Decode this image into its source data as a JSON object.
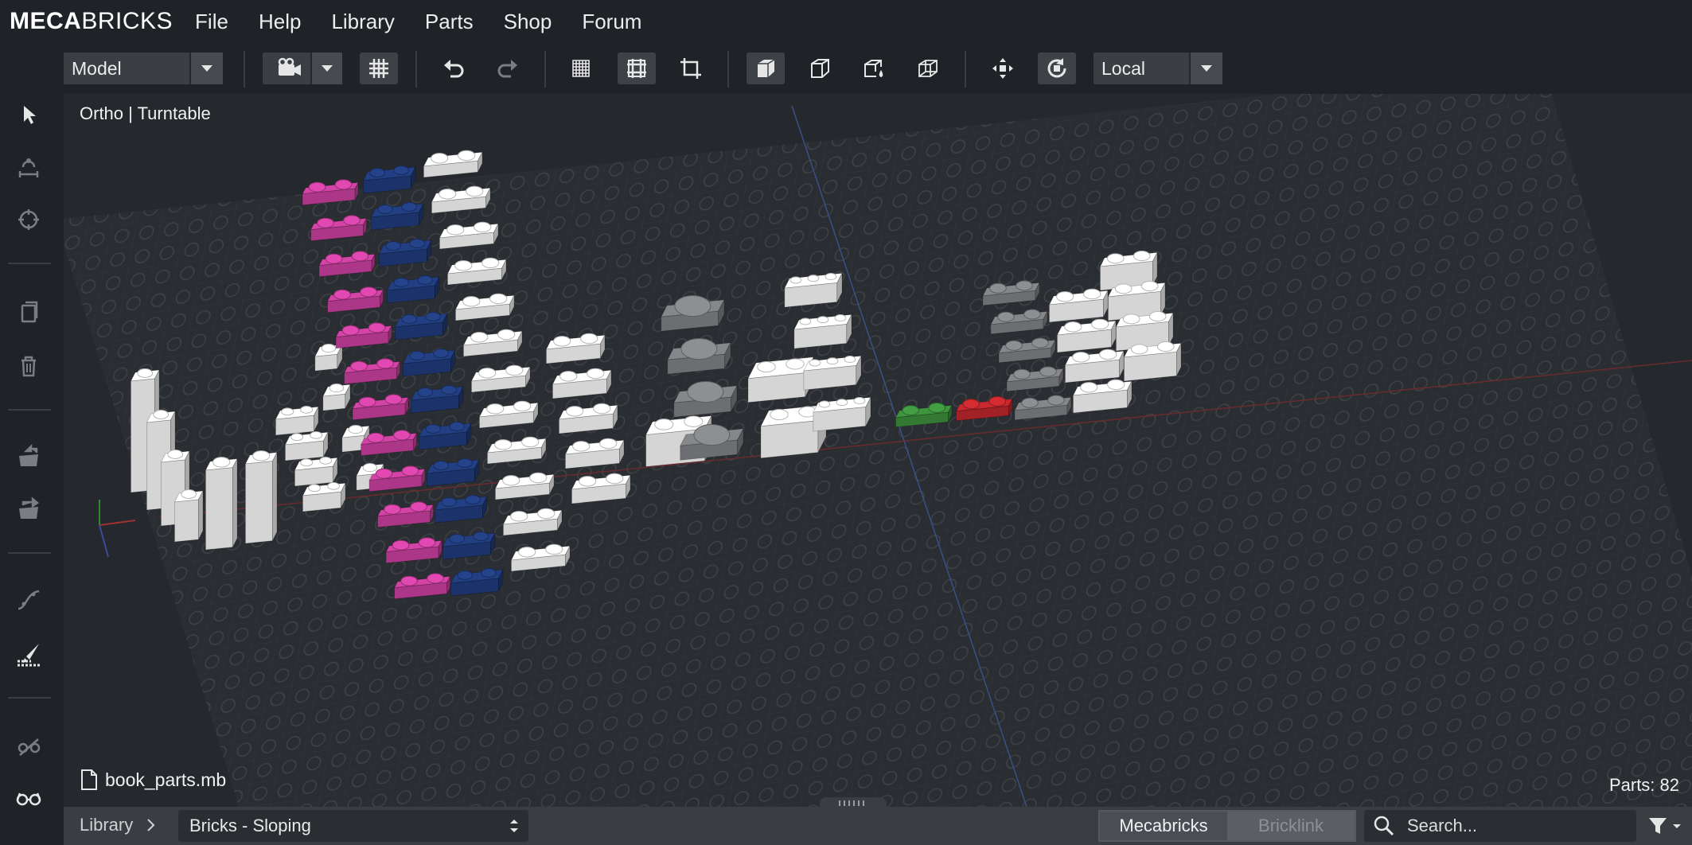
{
  "app": {
    "logo_bold": "MECA",
    "logo_light": "BRICKS"
  },
  "menu": {
    "items": [
      "File",
      "Help",
      "Library",
      "Parts",
      "Shop",
      "Forum"
    ]
  },
  "toolbar": {
    "mode_select": "Model",
    "space_select": "Local",
    "icons": [
      "camera-icon",
      "grid-icon",
      "undo-icon",
      "redo-icon",
      "fine-grid-icon",
      "coarse-grid-icon",
      "crop-icon",
      "solid-shading-icon",
      "wireframe-icon",
      "paint-shading-icon",
      "transparent-shading-icon",
      "move-icon",
      "rotate-icon"
    ],
    "active": [
      "coarse-grid-icon",
      "solid-shading-icon",
      "rotate-icon"
    ]
  },
  "left_tools": [
    "select-icon",
    "measure-icon",
    "target-icon",
    "copy-icon",
    "delete-icon",
    "import-icon",
    "export-icon",
    "curve-icon",
    "paint-icon",
    "hide-icon",
    "view-glasses-icon"
  ],
  "viewport": {
    "view_mode": "Ortho | Turntable",
    "file_name": "book_parts.mb",
    "parts_count": "Parts: 82"
  },
  "bottom_bar": {
    "breadcrumb_root": "Library",
    "category": "Bricks - Sloping",
    "source_tabs": [
      "Mecabricks",
      "Bricklink"
    ],
    "active_source": "Mecabricks",
    "search_placeholder": "Search..."
  },
  "colors": {
    "magenta": "#c43f9a",
    "dark_blue": "#1f3a78",
    "white": "#f2f2f2",
    "gray": "#7b7d80",
    "green": "#3a8a3a",
    "red": "#b8262b",
    "baseplate": "#2a2d31"
  }
}
